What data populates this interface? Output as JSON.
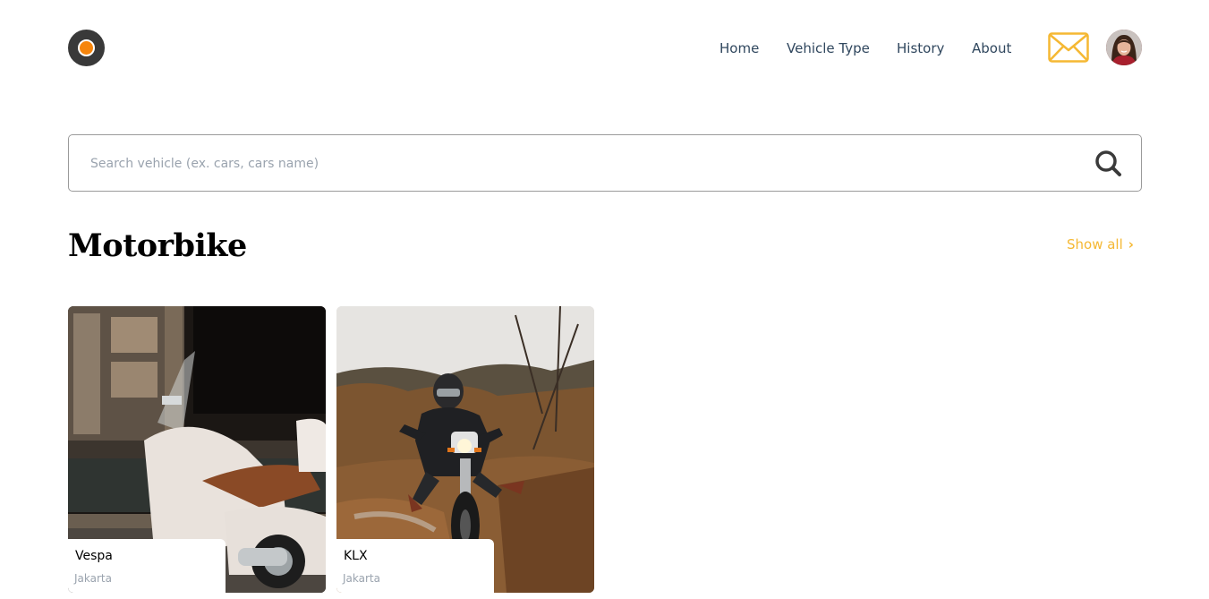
{
  "nav": {
    "items": [
      {
        "label": "Home"
      },
      {
        "label": "Vehicle Type"
      },
      {
        "label": "History"
      },
      {
        "label": "About"
      }
    ]
  },
  "icons": {
    "logo": "logo-icon",
    "mail": "mail-icon",
    "avatar": "user-avatar",
    "search": "search-icon",
    "chevron": "chevron-right-icon"
  },
  "colors": {
    "accent": "#f5b833",
    "logo_outer": "#393939",
    "logo_inner": "#f6850c",
    "nav_text": "#30475e"
  },
  "search": {
    "placeholder": "Search vehicle (ex. cars, cars name)",
    "value": ""
  },
  "section": {
    "title": "Motorbike",
    "show_all": "Show all"
  },
  "vehicles": [
    {
      "name": "Vespa",
      "city": "Jakarta"
    },
    {
      "name": "KLX",
      "city": "Jakarta"
    }
  ]
}
